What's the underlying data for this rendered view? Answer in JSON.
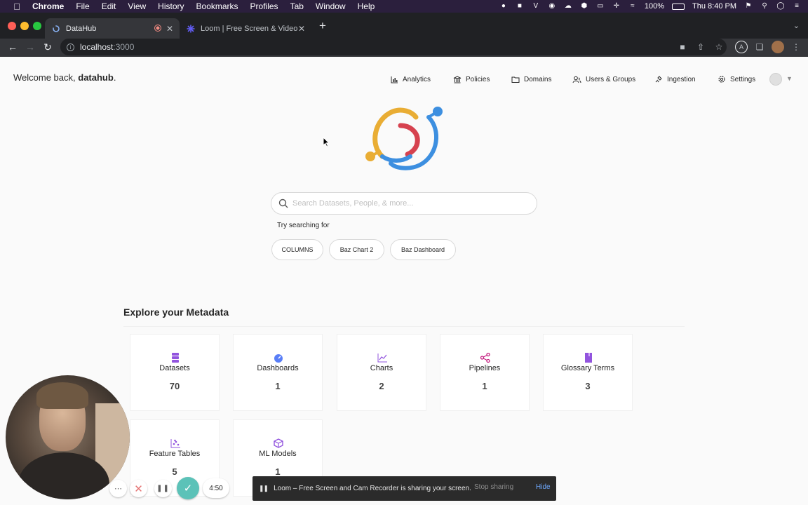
{
  "mac_menubar": {
    "items": [
      "Chrome",
      "File",
      "Edit",
      "View",
      "History",
      "Bookmarks",
      "Profiles",
      "Tab",
      "Window",
      "Help"
    ],
    "battery": "100%",
    "clock": "Thu 8:40 PM",
    "icons": [
      "apple-icon",
      "mic-icon",
      "camera-icon",
      "vectorworks-icon",
      "onepassword-icon",
      "cloud-icon",
      "honey-icon",
      "airplay-icon",
      "move-icon",
      "wifi-icon",
      "battery-icon",
      "flag-icon",
      "spotlight-icon",
      "siri-icon",
      "control-center-icon"
    ]
  },
  "browser": {
    "tabs": [
      {
        "title": "DataHub",
        "icon": "datahub-favicon"
      },
      {
        "title": "Loom | Free Screen & Video Rec",
        "icon": "loom-favicon"
      }
    ],
    "url_host": "localhost",
    "url_port": ":3000"
  },
  "header": {
    "welcome_prefix": "Welcome back, ",
    "username": "datahub",
    "welcome_suffix": ".",
    "nav": [
      {
        "label": "Analytics",
        "icon": "bar-chart-icon"
      },
      {
        "label": "Policies",
        "icon": "bank-icon"
      },
      {
        "label": "Domains",
        "icon": "folder-icon"
      },
      {
        "label": "Users & Groups",
        "icon": "users-icon"
      },
      {
        "label": "Ingestion",
        "icon": "api-icon"
      },
      {
        "label": "Settings",
        "icon": "gear-icon"
      }
    ]
  },
  "search": {
    "placeholder": "Search Datasets, People, & more...",
    "try_label": "Try searching for",
    "suggestions": [
      "COLUMNS",
      "Baz Chart 2",
      "Baz Dashboard"
    ]
  },
  "explore": {
    "title": "Explore your Metadata",
    "cards": [
      {
        "name": "Datasets",
        "count": "70",
        "icon": "database-icon",
        "color": "#9254de"
      },
      {
        "name": "Dashboards",
        "count": "1",
        "icon": "dashboard-icon",
        "color": "#597ef7"
      },
      {
        "name": "Charts",
        "count": "2",
        "icon": "line-chart-icon",
        "color": "#9254de"
      },
      {
        "name": "Pipelines",
        "count": "1",
        "icon": "share-icon",
        "color": "#c41d7f"
      },
      {
        "name": "Glossary Terms",
        "count": "3",
        "icon": "book-icon",
        "color": "#9254de"
      },
      {
        "name": "Feature Tables",
        "count": "5",
        "icon": "dot-chart-icon",
        "color": "#9254de"
      },
      {
        "name": "ML Models",
        "count": "1",
        "icon": "code-sandbox-icon",
        "color": "#9254de"
      }
    ]
  },
  "loom": {
    "timer": "4:50",
    "share_message": "Loom – Free Screen and Cam Recorder is sharing your screen.",
    "stop_label": "Stop sharing",
    "hide_label": "Hide",
    "accent": "#5cc2b8"
  }
}
